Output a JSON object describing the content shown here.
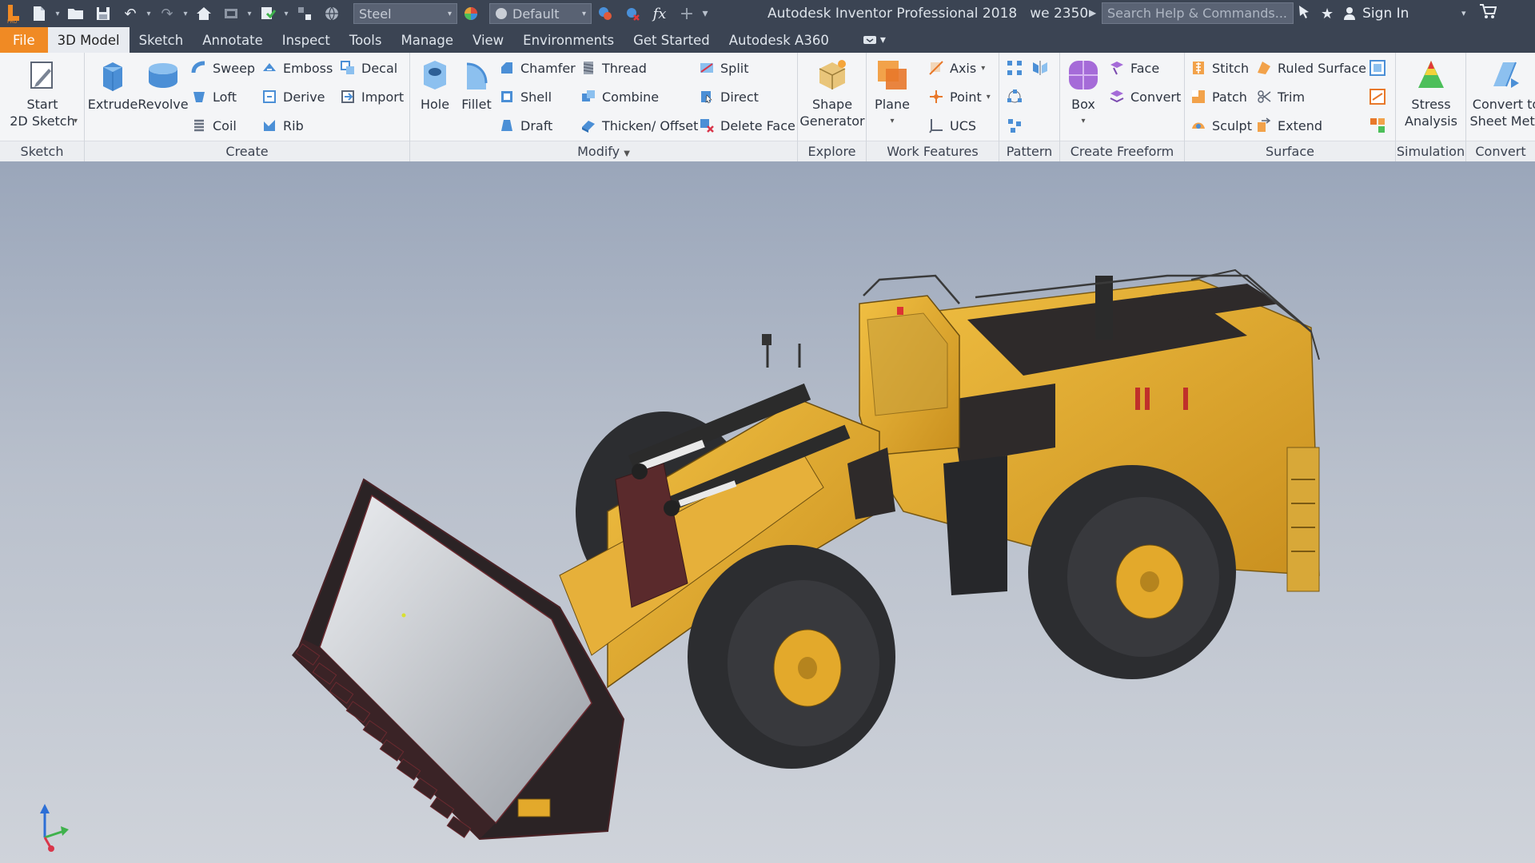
{
  "titlebar": {
    "app_title": "Autodesk Inventor Professional 2018",
    "doc_name": "we 2350",
    "material": "Steel",
    "appearance": "Default",
    "search_placeholder": "Search Help & Commands...",
    "sign_in": "Sign In"
  },
  "tabs": [
    {
      "label": "File"
    },
    {
      "label": "3D Model"
    },
    {
      "label": "Sketch"
    },
    {
      "label": "Annotate"
    },
    {
      "label": "Inspect"
    },
    {
      "label": "Tools"
    },
    {
      "label": "Manage"
    },
    {
      "label": "View"
    },
    {
      "label": "Environments"
    },
    {
      "label": "Get Started"
    },
    {
      "label": "Autodesk A360"
    }
  ],
  "ribbon": {
    "sketch": {
      "title": "Sketch",
      "start_line1": "Start",
      "start_line2": "2D Sketch"
    },
    "create": {
      "title": "Create",
      "extrude": "Extrude",
      "revolve": "Revolve",
      "sweep": "Sweep",
      "loft": "Loft",
      "coil": "Coil",
      "emboss": "Emboss",
      "derive": "Derive",
      "rib": "Rib",
      "decal": "Decal",
      "import": "Import"
    },
    "modify": {
      "title": "Modify",
      "hole": "Hole",
      "fillet": "Fillet",
      "chamfer": "Chamfer",
      "shell": "Shell",
      "draft": "Draft",
      "thread": "Thread",
      "combine": "Combine",
      "thicken": "Thicken/ Offset",
      "split": "Split",
      "direct": "Direct",
      "delete_face": "Delete Face"
    },
    "explore": {
      "title": "Explore",
      "shape_line1": "Shape",
      "shape_line2": "Generator"
    },
    "work": {
      "title": "Work Features",
      "plane": "Plane",
      "axis": "Axis",
      "point": "Point",
      "ucs": "UCS"
    },
    "pattern": {
      "title": "Pattern"
    },
    "freeform": {
      "title": "Create Freeform",
      "box": "Box",
      "face": "Face",
      "convert": "Convert"
    },
    "surface": {
      "title": "Surface",
      "stitch": "Stitch",
      "patch": "Patch",
      "sculpt": "Sculpt",
      "ruled": "Ruled Surface",
      "trim": "Trim",
      "extend": "Extend"
    },
    "simulation": {
      "title": "Simulation",
      "stress_line1": "Stress",
      "stress_line2": "Analysis"
    },
    "convert": {
      "title": "Convert",
      "sheet_line1": "Convert to",
      "sheet_line2": "Sheet Meta"
    }
  },
  "colors": {
    "file_tab": "#f08a24",
    "body_yellow": "#e4ad2c",
    "bucket_edge": "#3a2326"
  }
}
